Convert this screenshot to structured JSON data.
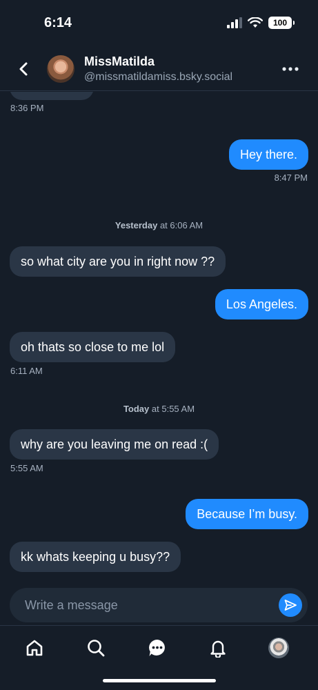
{
  "status_bar": {
    "time": "6:14",
    "battery": "100"
  },
  "header": {
    "name": "MissMatilda",
    "handle": "@missmatildamiss.bsky.social"
  },
  "messages": {
    "prev_time": "8:36 PM",
    "m1": {
      "text": "Hey there.",
      "time": "8:47 PM"
    },
    "sep1": {
      "day": "Yesterday",
      "rest": " at 6:06 AM"
    },
    "m2": {
      "text": "so what city are you in right now ??"
    },
    "m3": {
      "text": "Los Angeles."
    },
    "m4": {
      "text": "oh thats so close to me lol",
      "time": "6:11 AM"
    },
    "sep2": {
      "day": "Today",
      "rest": " at 5:55 AM"
    },
    "m5": {
      "text": "why are you leaving me on read :(",
      "time": "5:55 AM"
    },
    "m6": {
      "text": "Because I’m busy."
    },
    "m7": {
      "text": "kk whats keeping u busy??"
    }
  },
  "composer": {
    "placeholder": "Write a message"
  },
  "nav": {
    "items": [
      "home-icon",
      "search-icon",
      "chat-icon",
      "bell-icon",
      "profile-avatar"
    ]
  },
  "colors": {
    "background": "#151d28",
    "incoming": "#2a3646",
    "outgoing": "#208bfe"
  }
}
